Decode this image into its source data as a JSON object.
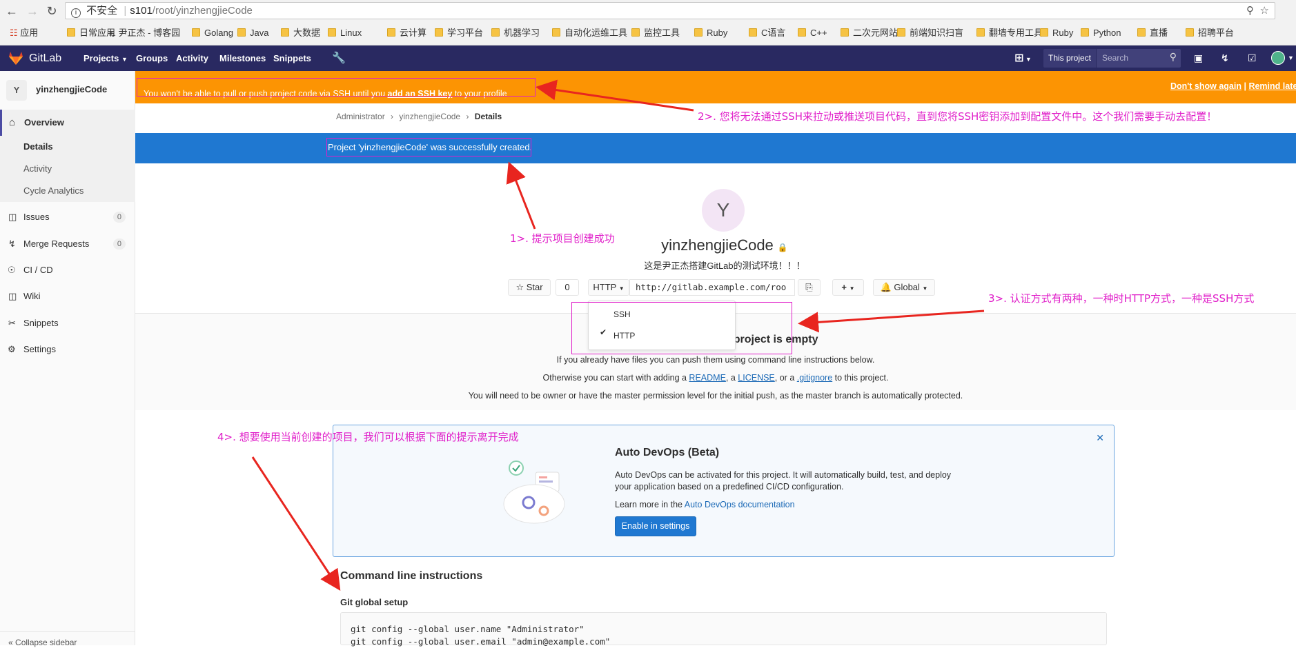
{
  "browser": {
    "security_label": "不安全",
    "url_host": "s101",
    "url_path": "/root/yinzhengjieCode",
    "bookmarks": [
      "应用",
      "日常应用",
      "尹正杰 - 博客园",
      "Golang",
      "Java",
      "大数据",
      "Linux",
      "云计算",
      "学习平台",
      "机器学习",
      "自动化运维工具",
      "监控工具",
      "Ruby",
      "C语言",
      "C++",
      "二次元网站",
      "前端知识扫盲",
      "翻墙专用工具",
      "Ruby",
      "Python",
      "直播",
      "招聘平台"
    ]
  },
  "navbar": {
    "brand": "GitLab",
    "items": [
      "Projects",
      "Groups",
      "Activity",
      "Milestones",
      "Snippets"
    ],
    "scope": "This project",
    "search_placeholder": "Search"
  },
  "sidebar": {
    "project_initial": "Y",
    "project_name": "yinzhengjieCode",
    "overview": "Overview",
    "sub_items": [
      "Details",
      "Activity",
      "Cycle Analytics"
    ],
    "items": [
      {
        "label": "Issues",
        "count": "0"
      },
      {
        "label": "Merge Requests",
        "count": "0"
      },
      {
        "label": "CI / CD"
      },
      {
        "label": "Wiki"
      },
      {
        "label": "Snippets"
      },
      {
        "label": "Settings"
      }
    ],
    "collapse": "Collapse sidebar"
  },
  "ssh_banner": {
    "text_before": "You won't be able to pull or push project code via SSH until you ",
    "link": "add an SSH key",
    "text_after": " to your profile",
    "dont_show": "Don't show again",
    "sep": "|",
    "remind": "Remind later"
  },
  "breadcrumb": [
    "Administrator",
    "yinzhengjieCode",
    "Details"
  ],
  "flash": "Project 'yinzhengjieCode' was successfully created.",
  "project": {
    "initial": "Y",
    "name": "yinzhengjieCode",
    "description": "这是尹正杰搭建GitLab的测试环境！！！",
    "star_label": "Star",
    "star_count": "0",
    "protocol": "HTTP",
    "clone_url": "http://gitlab.example.com/roo",
    "notification": "Global",
    "dropdown_options": [
      "SSH",
      "HTTP"
    ],
    "selected_option": "HTTP"
  },
  "empty": {
    "title": "The repository for this project is empty",
    "title_visible": "s project is empty",
    "line1": "If you already have files you can push them using command line instructions below.",
    "line2_before": "Otherwise you can start with adding a ",
    "readme": "README",
    "comma": ", a ",
    "license": "LICENSE",
    "or": ", or a ",
    "gitignore": ".gitignore",
    "line2_after": " to this project.",
    "line3": "You will need to be owner or have the master permission level for the initial push, as the master branch is automatically protected."
  },
  "devops": {
    "title": "Auto DevOps (Beta)",
    "desc1": "Auto DevOps can be activated for this project. It will automatically build, test, and deploy",
    "desc2": "your application based on a predefined CI/CD configuration.",
    "learn_before": "Learn more in the ",
    "learn_link": "Auto DevOps documentation",
    "button": "Enable in settings"
  },
  "cli": {
    "heading": "Command line instructions",
    "subheading": "Git global setup",
    "lines": [
      "git config --global user.name \"Administrator\"",
      "git config --global user.email \"admin@example.com\""
    ]
  },
  "annotations": {
    "a1": "1>. 提示项目创建成功",
    "a2": "2>. 您将无法通过SSH来拉动或推送项目代码，直到您将SSH密钥添加到配置文件中。这个我们需要手动去配置！",
    "a3": "3>. 认证方式有两种，一种时HTTP方式，一种是SSH方式",
    "a4": "4>. 想要使用当前创建的项目，我们可以根据下面的提示离开完成"
  },
  "colors": {
    "navbar": "#292961",
    "banner": "#fc9403",
    "flash": "#1f78d1",
    "annotation": "#e01ec9",
    "link": "#1b69b6"
  }
}
